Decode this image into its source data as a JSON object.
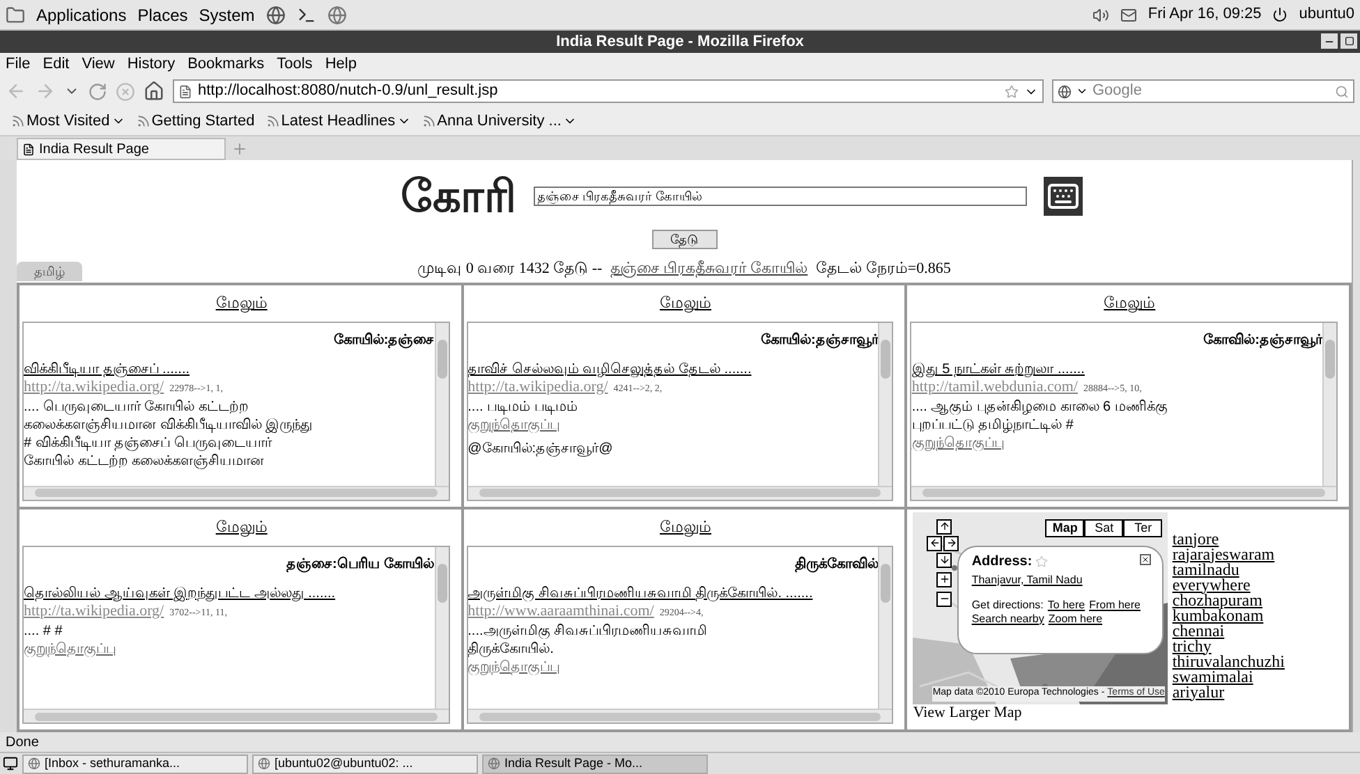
{
  "top_panel": {
    "menus": [
      "Applications",
      "Places",
      "System"
    ],
    "clock": "Fri Apr 16, 09:25",
    "user": "ubuntu0"
  },
  "window": {
    "title": "India Result Page - Mozilla Firefox"
  },
  "menu_bar": [
    "File",
    "Edit",
    "View",
    "History",
    "Bookmarks",
    "Tools",
    "Help"
  ],
  "address_bar": {
    "value": "http://localhost:8080/nutch-0.9/unl_result.jsp"
  },
  "search_bar": {
    "placeholder": "Google"
  },
  "bookmarks": [
    {
      "label": "Most Visited",
      "menu": true
    },
    {
      "label": "Getting Started",
      "menu": false
    },
    {
      "label": "Latest Headlines",
      "menu": true
    },
    {
      "label": "Anna University ...",
      "menu": true
    }
  ],
  "tabs": [
    {
      "label": "India Result Page",
      "selected": true
    }
  ],
  "page": {
    "logo": "கோரி",
    "query": "தஞ்சை பிரகதீசுவரர் கோயில்",
    "search_button": "தேடு",
    "language_tab": "தமிழ்",
    "summary": {
      "prefix": "முடிவு 0 வரை 1432 தேடு --",
      "query_link": "தஞ்சை பிரகதீசுவரர் கோயில்",
      "time": "தேடல் நேரம்=0.865"
    },
    "panels": [
      {
        "kind": "results",
        "more": "மேலும்",
        "heading": "கோயில்:தஞ்சை",
        "title": "விக்கிபீடியா தஞ்சைப் .......",
        "url": "http://ta.wikipedia.org/",
        "meta": "22978-->1, 1,",
        "lines": [
          ".... பெருவுடையார் கோயில் கட்டற்ற",
          "கலைக்களஞ்சியமான விக்கிபீடியாவில் இருந்து",
          "# விக்கிபீடியா தஞ்சைப் பெருவுடையார்",
          "கோயில் கட்டற்ற கலைக்களஞ்சியமான"
        ]
      },
      {
        "kind": "results",
        "more": "மேலும்",
        "heading": "கோயில்:தஞ்சாவூர்",
        "title": "தாவிச் செல்லவும் வழிசெலுத்தல் தேடல் .......",
        "url": "http://ta.wikipedia.org/",
        "meta": "4241-->2, 2,",
        "lines": [
          ".... படிமம் படிமம்"
        ],
        "cached": "குறுந்தொகுப்பு",
        "tag": "@கோயில்:தஞ்சாவூர்@"
      },
      {
        "kind": "results",
        "more": "மேலும்",
        "heading": "கோவில்:தஞ்சாவூர்",
        "title": "இது 5 நாட்கள் சுற்றுலா .......",
        "url": "http://tamil.webdunia.com/",
        "meta": "28884-->5, 10,",
        "lines": [
          ".... ஆகும் புதன்கிழமை காலை 6 மணிக்கு",
          "புறப்பட்டு தமிழ்நாட்டில் #"
        ],
        "cached": "குறுந்தொகுப்பு"
      },
      {
        "kind": "results",
        "more": "மேலும்",
        "heading": "தஞ்சை:பெரிய கோயில்",
        "title": "தொல்லியல் ஆய்வுகள் இறந்துபட்ட அல்லது .......",
        "url": "http://ta.wikipedia.org/",
        "meta": "3702-->11, 11,",
        "lines": [
          ".... # #"
        ],
        "cached": "குறுந்தொகுப்பு"
      },
      {
        "kind": "results",
        "more": "மேலும்",
        "heading": "திருக்கோவில்",
        "title": "அருள்மிகு சிவசுப்பிரமணியசுவாமி திருக்கோயில். .......",
        "url": "http://www.aaraamthinai.com/",
        "meta": "29204-->4,",
        "lines": [
          "....அருள்மிகு சிவசுப்பிரமணியசுவாமி",
          "திருக்கோயில்."
        ],
        "cached": "குறுந்தொகுப்பு"
      },
      {
        "kind": "map",
        "map_types": [
          {
            "label": "Map",
            "selected": true
          },
          {
            "label": "Sat",
            "selected": false
          },
          {
            "label": "Ter",
            "selected": false
          }
        ],
        "info": {
          "title": "Address:",
          "address": "Thanjavur, Tamil Nadu",
          "directions_label": "Get directions:",
          "to_here": "To here",
          "from_here": "From here",
          "search_nearby": "Search nearby",
          "zoom_here": "Zoom here"
        },
        "attribution": "Map data ©2010 Europa Technologies -",
        "terms": "Terms of Use",
        "larger": "View Larger Map",
        "places": [
          "tanjore",
          "rajarajeswaram",
          "tamilnadu",
          "everywhere",
          "chozhapuram",
          "kumbakonam",
          "chennai",
          "trichy",
          "thiruvalanchuzhi",
          "swamimalai",
          "ariyalur"
        ]
      }
    ]
  },
  "status_bar": "Done",
  "taskbar": [
    {
      "label": "[Inbox - sethuramanka...",
      "selected": false
    },
    {
      "label": "[ubuntu02@ubuntu02: ...",
      "selected": false
    },
    {
      "label": "India Result Page - Mo...",
      "selected": true
    }
  ]
}
